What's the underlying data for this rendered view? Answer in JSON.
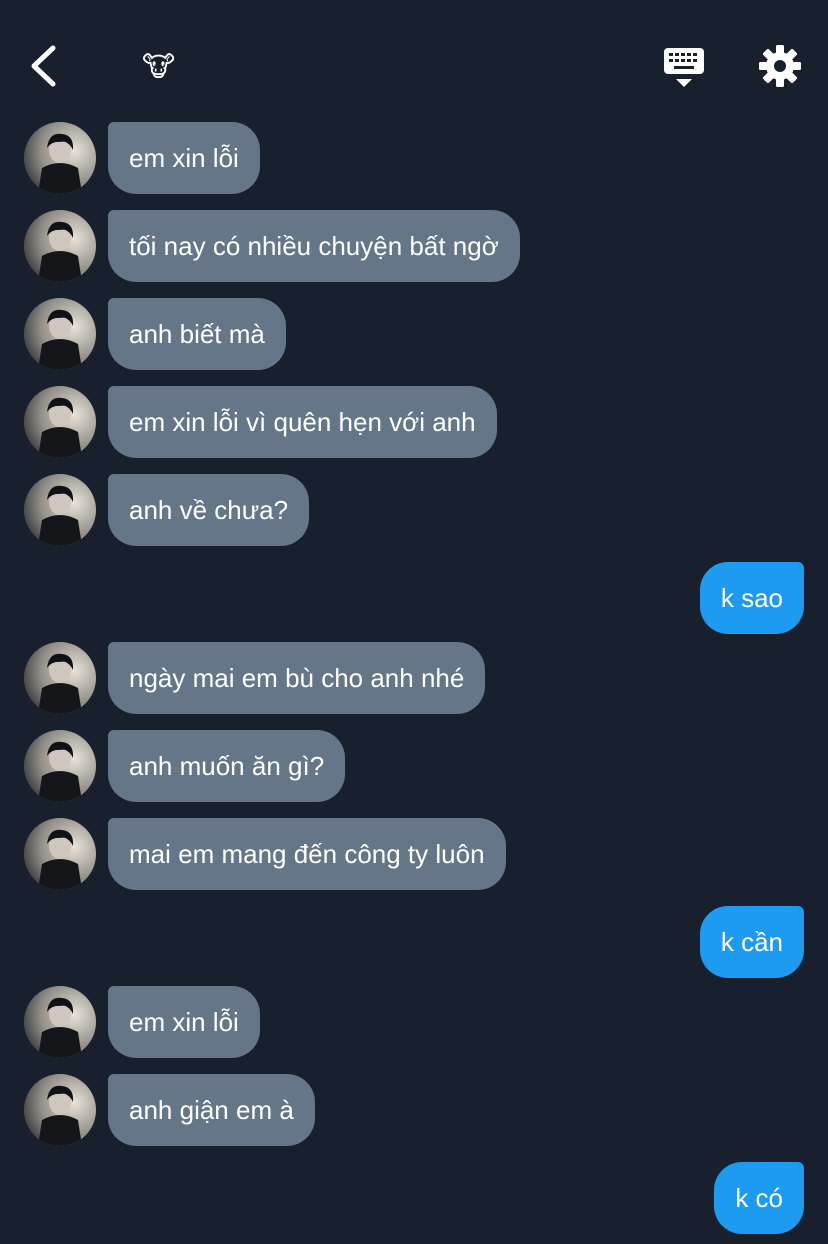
{
  "header": {
    "back_icon": "chevron-left-icon",
    "contact_emoji": "🐮",
    "keyboard_icon": "keyboard-icon",
    "settings_icon": "gear-icon"
  },
  "colors": {
    "background": "#17202c",
    "incoming_bubble": "#647687",
    "outgoing_bubble": "#1d9bf0"
  },
  "messages": [
    {
      "from": "them",
      "text": "em xin lỗi"
    },
    {
      "from": "them",
      "text": "tối nay có nhiều chuyện bất ngờ"
    },
    {
      "from": "them",
      "text": "anh biết mà"
    },
    {
      "from": "them",
      "text": "em xin lỗi vì quên hẹn với anh"
    },
    {
      "from": "them",
      "text": "anh về chưa?"
    },
    {
      "from": "me",
      "text": "k sao"
    },
    {
      "from": "them",
      "text": "ngày mai em bù cho anh nhé"
    },
    {
      "from": "them",
      "text": "anh muốn ăn gì?"
    },
    {
      "from": "them",
      "text": "mai em mang đến công ty luôn"
    },
    {
      "from": "me",
      "text": "k cần"
    },
    {
      "from": "them",
      "text": "em xin lỗi"
    },
    {
      "from": "them",
      "text": "anh giận em à"
    },
    {
      "from": "me",
      "text": "k có"
    }
  ]
}
